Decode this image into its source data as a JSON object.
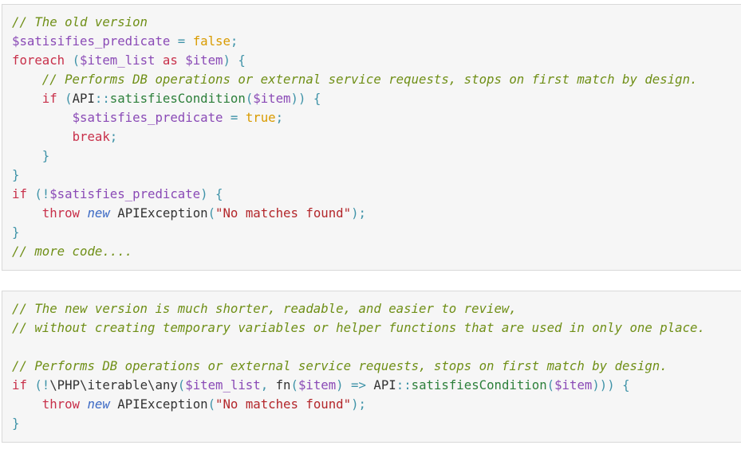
{
  "colors": {
    "background": "#f6f6f6",
    "border": "#d9d9d9",
    "comment": "#6f8f16",
    "variable": "#8a4ab6",
    "boolean": "#d99b00",
    "keyword": "#c8304a",
    "operator": "#3f93a8",
    "function": "#2c7f3a",
    "new_keyword": "#3a68c4",
    "string": "#b3262a",
    "plain": "#333333"
  },
  "blocks": [
    {
      "lines": [
        [
          {
            "t": "comment",
            "v": "// The old version"
          }
        ],
        [
          {
            "t": "var",
            "v": "$satisifies_predicate"
          },
          {
            "t": "op",
            "v": " = "
          },
          {
            "t": "bool",
            "v": "false"
          },
          {
            "t": "op",
            "v": ";"
          }
        ],
        [
          {
            "t": "kw",
            "v": "foreach"
          },
          {
            "t": "op",
            "v": " ("
          },
          {
            "t": "var",
            "v": "$item_list"
          },
          {
            "t": "plain",
            "v": " "
          },
          {
            "t": "kw",
            "v": "as"
          },
          {
            "t": "plain",
            "v": " "
          },
          {
            "t": "var",
            "v": "$item"
          },
          {
            "t": "op",
            "v": ") {"
          }
        ],
        [
          {
            "t": "plain",
            "v": "    "
          },
          {
            "t": "comment",
            "v": "// Performs DB operations or external service requests, stops on first match by design."
          }
        ],
        [
          {
            "t": "plain",
            "v": "    "
          },
          {
            "t": "kw",
            "v": "if"
          },
          {
            "t": "op",
            "v": " ("
          },
          {
            "t": "plain",
            "v": "API"
          },
          {
            "t": "op",
            "v": "::"
          },
          {
            "t": "fn",
            "v": "satisfiesCondition"
          },
          {
            "t": "op",
            "v": "("
          },
          {
            "t": "var",
            "v": "$item"
          },
          {
            "t": "op",
            "v": ")) {"
          }
        ],
        [
          {
            "t": "plain",
            "v": "        "
          },
          {
            "t": "var",
            "v": "$satisfies_predicate"
          },
          {
            "t": "op",
            "v": " = "
          },
          {
            "t": "bool",
            "v": "true"
          },
          {
            "t": "op",
            "v": ";"
          }
        ],
        [
          {
            "t": "plain",
            "v": "        "
          },
          {
            "t": "kw",
            "v": "break"
          },
          {
            "t": "op",
            "v": ";"
          }
        ],
        [
          {
            "t": "plain",
            "v": "    "
          },
          {
            "t": "op",
            "v": "}"
          }
        ],
        [
          {
            "t": "op",
            "v": "}"
          }
        ],
        [
          {
            "t": "kw",
            "v": "if"
          },
          {
            "t": "op",
            "v": " (!"
          },
          {
            "t": "var",
            "v": "$satisfies_predicate"
          },
          {
            "t": "op",
            "v": ") {"
          }
        ],
        [
          {
            "t": "plain",
            "v": "    "
          },
          {
            "t": "kw",
            "v": "throw"
          },
          {
            "t": "plain",
            "v": " "
          },
          {
            "t": "new",
            "v": "new"
          },
          {
            "t": "plain",
            "v": " APIException"
          },
          {
            "t": "op",
            "v": "("
          },
          {
            "t": "str",
            "v": "\"No matches found\""
          },
          {
            "t": "op",
            "v": ");"
          }
        ],
        [
          {
            "t": "op",
            "v": "}"
          }
        ],
        [
          {
            "t": "comment",
            "v": "// more code...."
          }
        ]
      ]
    },
    {
      "lines": [
        [
          {
            "t": "comment",
            "v": "// The new version is much shorter, readable, and easier to review,"
          }
        ],
        [
          {
            "t": "comment",
            "v": "// without creating temporary variables or helper functions that are used in only one place."
          }
        ],
        [],
        [
          {
            "t": "comment",
            "v": "// Performs DB operations or external service requests, stops on first match by design."
          }
        ],
        [
          {
            "t": "kw",
            "v": "if"
          },
          {
            "t": "op",
            "v": " (!"
          },
          {
            "t": "plain",
            "v": "\\PHP\\iterable\\any"
          },
          {
            "t": "op",
            "v": "("
          },
          {
            "t": "var",
            "v": "$item_list"
          },
          {
            "t": "op",
            "v": ", "
          },
          {
            "t": "plain",
            "v": "fn"
          },
          {
            "t": "op",
            "v": "("
          },
          {
            "t": "var",
            "v": "$item"
          },
          {
            "t": "op",
            "v": ") => "
          },
          {
            "t": "plain",
            "v": "API"
          },
          {
            "t": "op",
            "v": "::"
          },
          {
            "t": "fn",
            "v": "satisfiesCondition"
          },
          {
            "t": "op",
            "v": "("
          },
          {
            "t": "var",
            "v": "$item"
          },
          {
            "t": "op",
            "v": "))) {"
          }
        ],
        [
          {
            "t": "plain",
            "v": "    "
          },
          {
            "t": "kw",
            "v": "throw"
          },
          {
            "t": "plain",
            "v": " "
          },
          {
            "t": "new",
            "v": "new"
          },
          {
            "t": "plain",
            "v": " APIException"
          },
          {
            "t": "op",
            "v": "("
          },
          {
            "t": "str",
            "v": "\"No matches found\""
          },
          {
            "t": "op",
            "v": ");"
          }
        ],
        [
          {
            "t": "op",
            "v": "}"
          }
        ]
      ]
    }
  ]
}
